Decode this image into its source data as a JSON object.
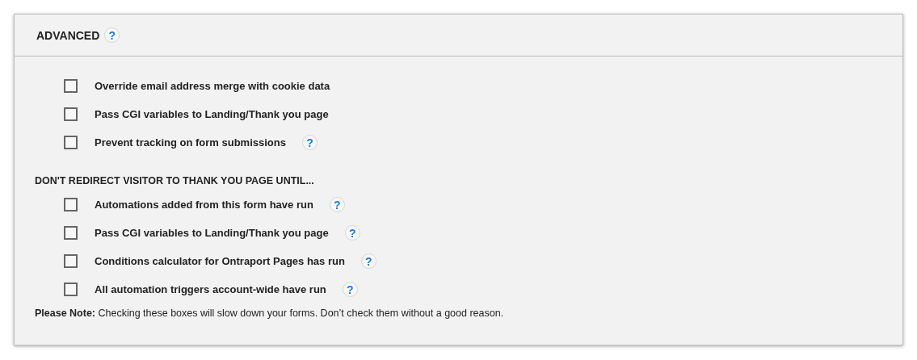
{
  "panel": {
    "title": "ADVANCED",
    "help": "?"
  },
  "options": [
    {
      "label": "Override email address merge with cookie data",
      "checked": false
    },
    {
      "label": "Pass CGI variables to Landing/Thank you page",
      "checked": false
    },
    {
      "label": "Prevent tracking on form submissions",
      "checked": false,
      "help": "?"
    }
  ],
  "redirect_section": {
    "heading": "DON'T REDIRECT VISITOR TO THANK YOU PAGE UNTIL...",
    "options": [
      {
        "label": "Automations added from this form have run",
        "checked": false,
        "help": "?"
      },
      {
        "label": "Pass CGI variables to Landing/Thank you page",
        "checked": false,
        "help": "?"
      },
      {
        "label": "Conditions calculator for Ontraport Pages has run",
        "checked": false,
        "help": "?"
      },
      {
        "label": "All automation triggers account-wide have run",
        "checked": false,
        "help": "?"
      }
    ]
  },
  "note": "**Please Note:** Checking these boxes will slow down your forms. Don’t check them without a good reason."
}
